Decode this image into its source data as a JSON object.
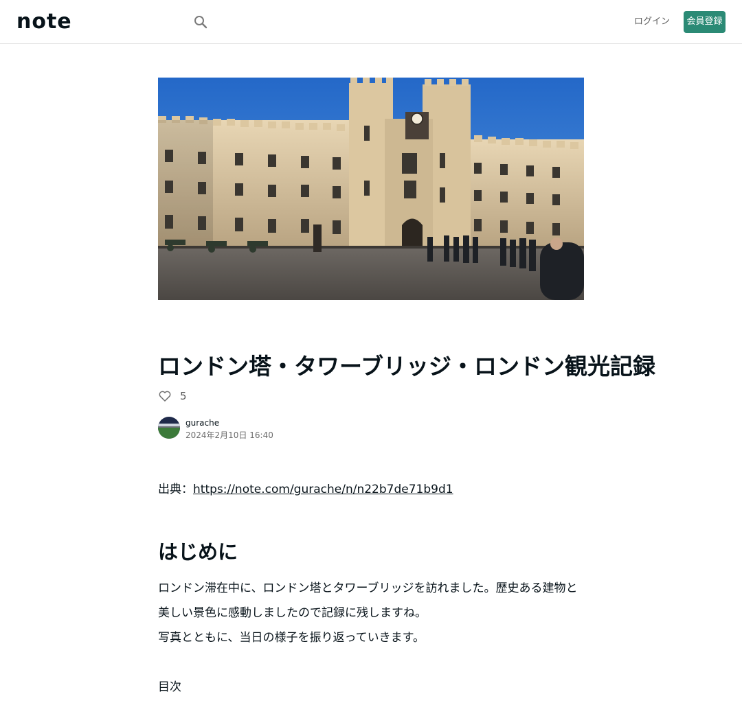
{
  "header": {
    "logo": "note",
    "search_icon": "search-icon",
    "login_label": "ログイン",
    "signup_label": "会員登録",
    "accent_color": "#2b8a75"
  },
  "article": {
    "title": "ロンドン塔・タワーブリッジ・ロンドン観光記録",
    "likes": "5",
    "author": {
      "name": "gurache",
      "date": "2024年2月10日 16:40"
    },
    "source_prefix": "出典：",
    "source_url": "https://note.com/gurache/n/n22b7de71b9d1",
    "section_heading": "はじめに",
    "paragraph_1a": "ロンドン滞在中に、ロンドン塔とタワーブリッジを訪れました。歴史ある建物と美しい景色に感動しましたので記録に残します",
    "paragraph_1b": "ね。",
    "paragraph_2": "写真とともに、当日の様子を振り返っていきます。",
    "paragraph_3": "目次"
  }
}
